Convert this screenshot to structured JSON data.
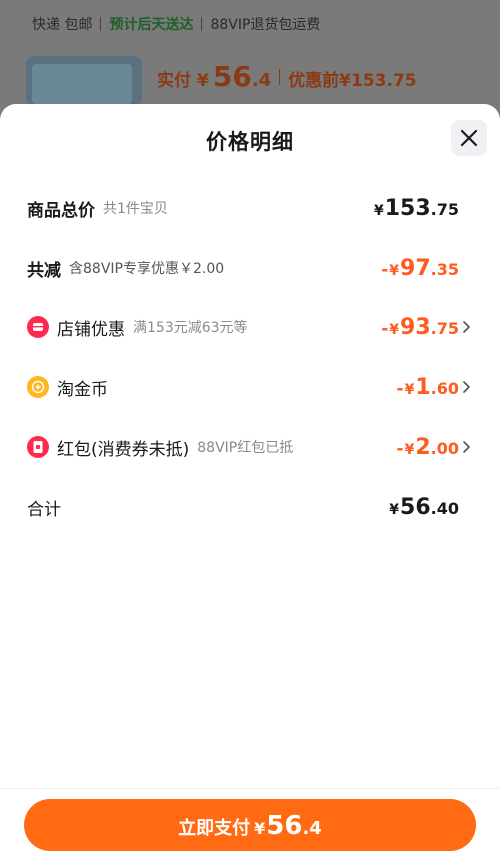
{
  "background": {
    "shipping": {
      "express": "快递 包邮",
      "delivery": "预计后天送达",
      "return": "88VIP退货包运费"
    },
    "price": {
      "label": "实付",
      "currency": "¥",
      "int": "56",
      "dec": ".4",
      "original": "优惠前¥153.75"
    }
  },
  "sheet": {
    "title": "价格明细",
    "rows": [
      {
        "label": "商品总价",
        "sub": "共1件宝贝",
        "amount": {
          "sign": "",
          "currency": "¥",
          "int": "153",
          "dec": ".75"
        }
      },
      {
        "label": "共减",
        "sub": "含88VIP专享优惠￥2.00",
        "amount": {
          "sign": "-",
          "currency": "¥",
          "int": "97",
          "dec": ".35"
        }
      },
      {
        "label": "店铺优惠",
        "sub": "满153元减63元等",
        "icon": "shop-coupon-icon",
        "amount": {
          "sign": "-",
          "currency": "¥",
          "int": "93",
          "dec": ".75"
        }
      },
      {
        "label": "淘金币",
        "sub": "",
        "icon": "taojinbi-coin-icon",
        "amount": {
          "sign": "-",
          "currency": "¥",
          "int": "1",
          "dec": ".60"
        }
      },
      {
        "label": "红包(消费券未抵)",
        "sub": "88VIP红包已抵",
        "icon": "red-packet-icon",
        "amount": {
          "sign": "-",
          "currency": "¥",
          "int": "2",
          "dec": ".00"
        }
      },
      {
        "label": "合计",
        "sub": "",
        "amount": {
          "sign": "",
          "currency": "¥",
          "int": "56",
          "dec": ".40"
        }
      }
    ]
  },
  "footer": {
    "pay_label": "立即支付",
    "currency": "¥",
    "int": "56",
    "dec": ".4"
  },
  "colors": {
    "accent": "#ff5a1f",
    "button": "#ff6a12",
    "icon_red": "#ff2a4d",
    "icon_gold": "#ffb51f"
  }
}
